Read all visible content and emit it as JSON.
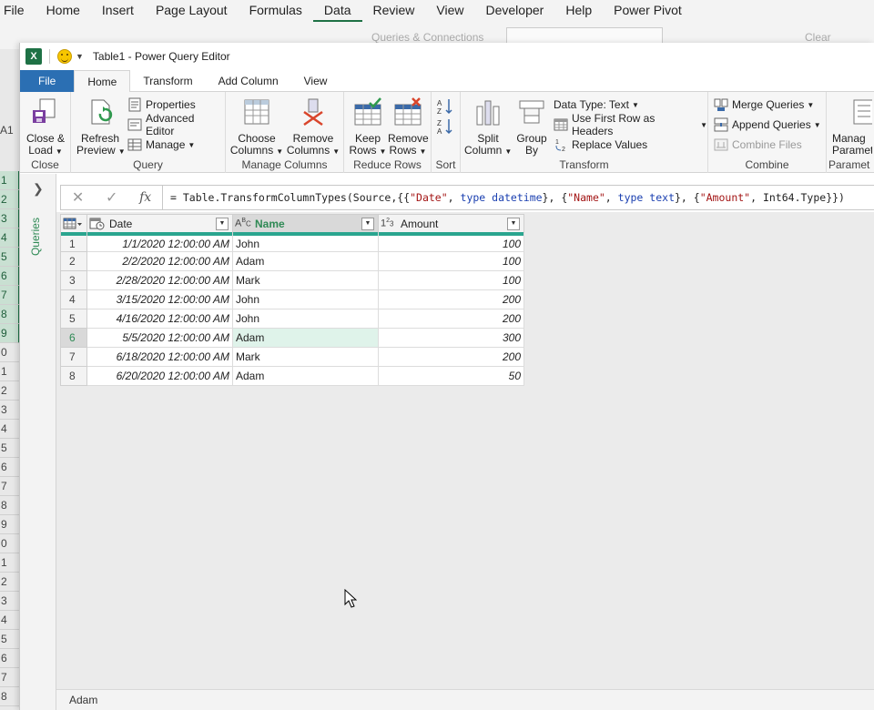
{
  "excel": {
    "menu": [
      "File",
      "Home",
      "Insert",
      "Page Layout",
      "Formulas",
      "Data",
      "Review",
      "View",
      "Developer",
      "Help",
      "Power Pivot"
    ],
    "active_menu": "Data",
    "ghost_queries": "Queries & Connections",
    "ghost_clear": "Clear",
    "name_box": "A1",
    "row_numbers": [
      "1",
      "2",
      "3",
      "4",
      "5",
      "6",
      "7",
      "8",
      "9",
      "0",
      "1",
      "2",
      "3",
      "4",
      "5",
      "6",
      "7",
      "8",
      "9",
      "0",
      "1",
      "2",
      "3",
      "4",
      "5",
      "6",
      "7",
      "8"
    ]
  },
  "window": {
    "title": "Table1 - Power Query Editor"
  },
  "tabs": [
    {
      "label": "File"
    },
    {
      "label": "Home"
    },
    {
      "label": "Transform"
    },
    {
      "label": "Add Column"
    },
    {
      "label": "View"
    }
  ],
  "ribbon": {
    "close": {
      "label": "Close",
      "close_load_1": "Close &",
      "close_load_2": "Load"
    },
    "query": {
      "label": "Query",
      "refresh_1": "Refresh",
      "refresh_2": "Preview",
      "properties": "Properties",
      "advanced_editor": "Advanced Editor",
      "manage": "Manage"
    },
    "manage_columns": {
      "label": "Manage Columns",
      "choose_1": "Choose",
      "choose_2": "Columns",
      "remove_1": "Remove",
      "remove_2": "Columns"
    },
    "reduce_rows": {
      "label": "Reduce Rows",
      "keep_1": "Keep",
      "keep_2": "Rows",
      "remove_1": "Remove",
      "remove_2": "Rows"
    },
    "sort": {
      "label": "Sort"
    },
    "transform": {
      "label": "Transform",
      "split_1": "Split",
      "split_2": "Column",
      "group_1": "Group",
      "group_2": "By",
      "data_type": "Data Type: Text",
      "first_row": "Use First Row as Headers",
      "replace": "Replace Values"
    },
    "combine": {
      "label": "Combine",
      "merge": "Merge Queries",
      "append": "Append Queries",
      "combine_files": "Combine Files"
    },
    "params": {
      "label": "Paramet",
      "manage_1": "Manag",
      "manage_2": "Paramete"
    }
  },
  "queries_pane": {
    "label": "Queries"
  },
  "formula": {
    "prefix": "= Table.TransformColumnTypes(Source,{{",
    "s1": "\"Date\"",
    "t1": "type",
    "v1": "datetime",
    "mid1": "}, {",
    "s2": "\"Name\"",
    "t2": "type",
    "v2": "text",
    "mid2": "}, {",
    "s3": "\"Amount\"",
    "v3": "Int64.Type",
    "suffix": "}})"
  },
  "table": {
    "columns": [
      {
        "name": "Date",
        "type_icon": "calendar-clock-icon"
      },
      {
        "name": "Name",
        "type_icon": "ABC"
      },
      {
        "name": "Amount",
        "type_icon": "123"
      }
    ],
    "rows": [
      {
        "n": "1",
        "date": "1/1/2020 12:00:00 AM",
        "name": "John",
        "amount": "100"
      },
      {
        "n": "2",
        "date": "2/2/2020 12:00:00 AM",
        "name": "Adam",
        "amount": "100"
      },
      {
        "n": "3",
        "date": "2/28/2020 12:00:00 AM",
        "name": "Mark",
        "amount": "100"
      },
      {
        "n": "4",
        "date": "3/15/2020 12:00:00 AM",
        "name": "John",
        "amount": "200"
      },
      {
        "n": "5",
        "date": "4/16/2020 12:00:00 AM",
        "name": "John",
        "amount": "200"
      },
      {
        "n": "6",
        "date": "5/5/2020 12:00:00 AM",
        "name": "Adam",
        "amount": "300"
      },
      {
        "n": "7",
        "date": "6/18/2020 12:00:00 AM",
        "name": "Mark",
        "amount": "200"
      },
      {
        "n": "8",
        "date": "6/20/2020 12:00:00 AM",
        "name": "Adam",
        "amount": "50"
      }
    ],
    "selected_row": 5
  },
  "status": {
    "preview_value": "Adam"
  },
  "colors": {
    "file_tab": "#2b6fb3",
    "accent": "#2f8a55",
    "quality_bar": "#2aa58f"
  }
}
